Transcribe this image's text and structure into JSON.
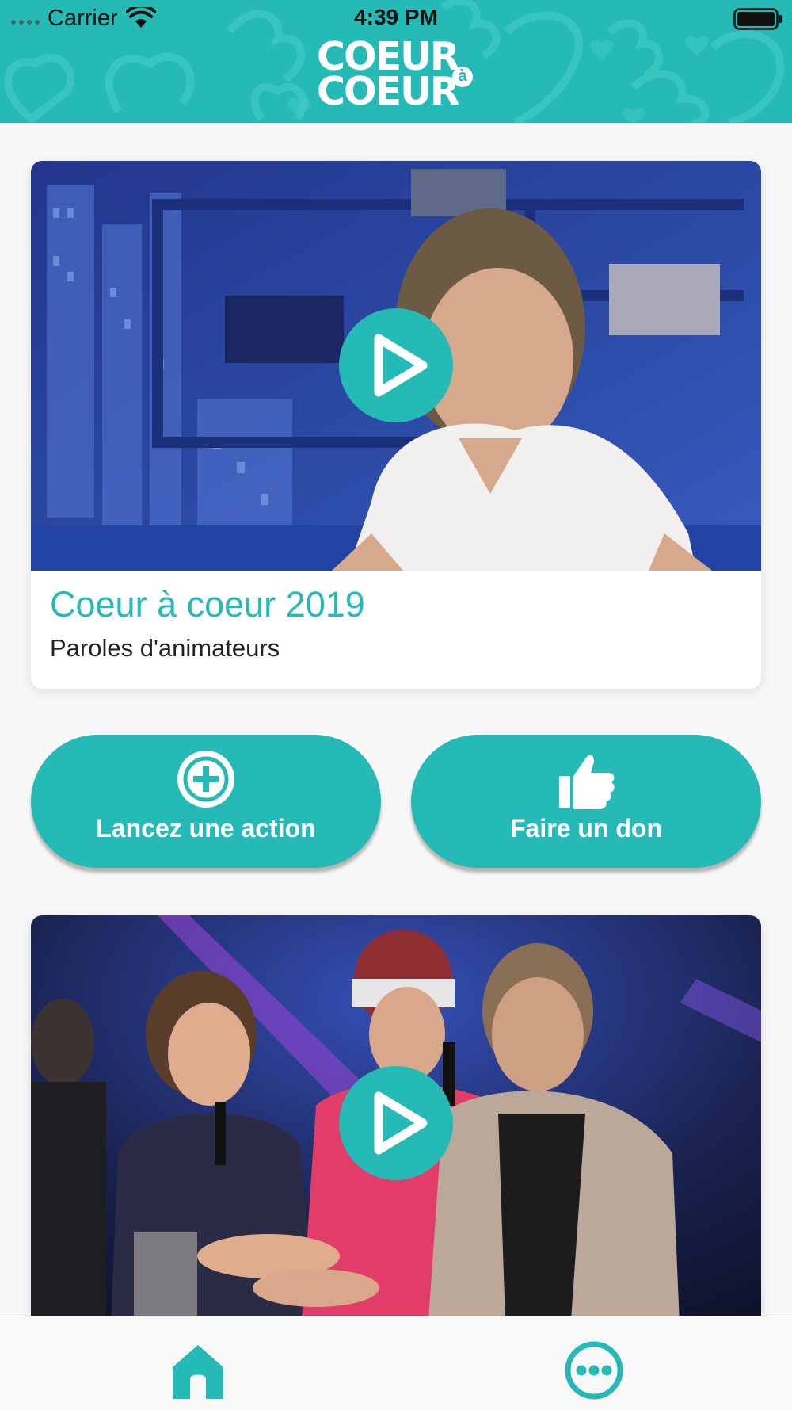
{
  "status_bar": {
    "carrier": "Carrier",
    "time": "4:39 PM"
  },
  "header": {
    "logo_line1": "COEUR",
    "logo_line2": "COEUR",
    "logo_mark": "à",
    "background_color": "#25bab5"
  },
  "cards": [
    {
      "title": "Coeur à coeur 2019",
      "subtitle": "Paroles d'animateurs",
      "play_icon": "play-icon"
    },
    {
      "play_icon": "play-icon"
    }
  ],
  "actions": {
    "launch_label": "Lancez une action",
    "launch_icon": "plus-circle-icon",
    "donate_label": "Faire un don",
    "donate_icon": "thumbs-up-icon"
  },
  "tab_bar": {
    "items": [
      {
        "icon": "home-icon",
        "active": true
      },
      {
        "icon": "more-icon",
        "active": false
      }
    ]
  },
  "colors": {
    "accent": "#25bab5",
    "text": "#222222",
    "background": "#f7f7f7"
  }
}
